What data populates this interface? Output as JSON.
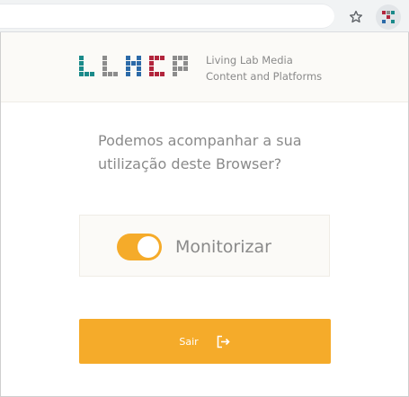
{
  "browser": {
    "bookmark_icon": "star-icon",
    "extension_icon": "lab-extension-icon"
  },
  "header": {
    "logo_name": "LLMCP",
    "tagline_line1": "Living Lab Media",
    "tagline_line2": "Content and Platforms",
    "logo_colors": {
      "teal": "#1a8a8a",
      "gray": "#8c8c8c",
      "blue": "#2c6aa8",
      "red": "#b2253c"
    }
  },
  "prompt": {
    "line1": "Podemos acompanhar a sua",
    "line2": "utilização deste Browser?"
  },
  "toggle": {
    "label": "Monitorizar",
    "checked": true,
    "accent_color": "#f5ab2a"
  },
  "exit_button": {
    "label": "Sair",
    "icon": "logout-icon"
  }
}
